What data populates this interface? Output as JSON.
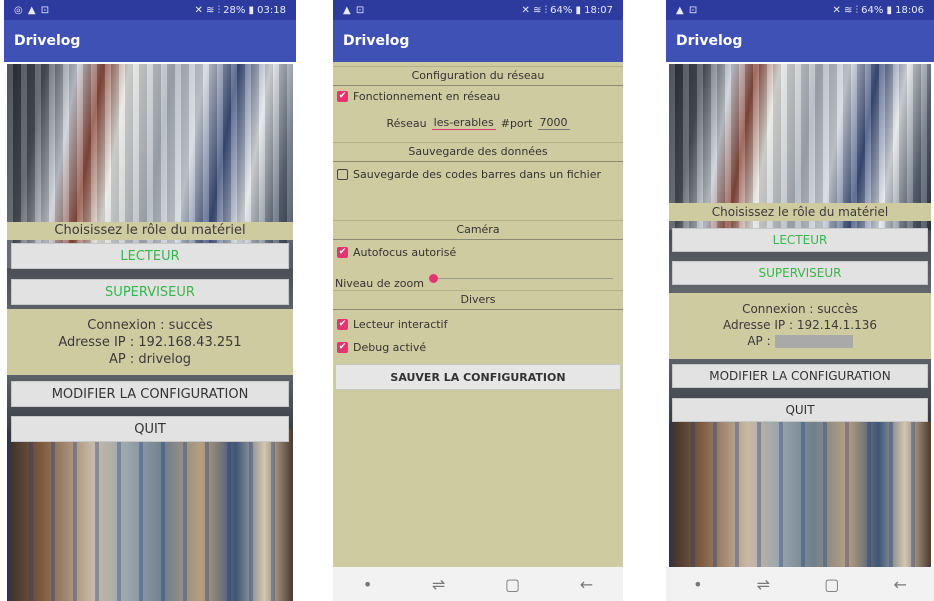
{
  "screens": [
    {
      "status": {
        "left": "◎ ▲ ⊡",
        "right": "28% ▮ 03:18"
      },
      "app_title": "Drivelog",
      "role_prompt": "Choisissez le rôle du matériel",
      "buttons": {
        "reader": "LECTEUR",
        "supervisor": "SUPERVISEUR",
        "modify": "MODIFIER LA CONFIGURATION",
        "quit": "QUIT"
      },
      "connection": {
        "status": "Connexion : succès",
        "ip": "Adresse IP : 192.168.43.251",
        "ap": "AP : drivelog"
      }
    },
    {
      "status": {
        "left": "▲ ⊡",
        "right": "64% ▮ 18:07"
      },
      "app_title": "Drivelog",
      "sections": {
        "network": "Configuration du réseau",
        "backup": "Sauvegarde des données",
        "camera": "Caméra",
        "misc": "Divers"
      },
      "options": {
        "network_mode": "Fonctionnement en réseau",
        "network_label": "Réseau",
        "network_value": "les-erables",
        "port_label": "#port",
        "port_value": "7000",
        "save_barcodes": "Sauvegarde des codes barres dans un fichier",
        "autofocus": "Autofocus autorisé",
        "zoom_label": "Niveau de zoom",
        "interactive_reader": "Lecteur interactif",
        "debug": "Debug activé"
      },
      "checks": {
        "network_mode": true,
        "save_barcodes": false,
        "autofocus": true,
        "interactive_reader": true,
        "debug": true
      },
      "zoom_level": 0,
      "save_button": "SAUVER LA CONFIGURATION"
    },
    {
      "status": {
        "left": "▲ ⊡",
        "right": "64% ▮ 18:06"
      },
      "app_title": "Drivelog",
      "role_prompt": "Choisissez le rôle du matériel",
      "buttons": {
        "reader": "LECTEUR",
        "supervisor": "SUPERVISEUR",
        "modify": "MODIFIER LA CONFIGURATION",
        "quit": "QUIT"
      },
      "connection": {
        "status": "Connexion : succès",
        "ip": "Adresse IP : 192.14.1.136",
        "ap": "AP :"
      }
    }
  ],
  "navbar_icons": [
    "dot-icon",
    "recent-apps-icon",
    "home-icon",
    "back-icon"
  ],
  "colors": {
    "app_bar": "#3f51b5",
    "status_bar": "#2d3a9e",
    "panel": "#cfcba0",
    "accent": "#e4356f",
    "green_text": "#39b54a"
  }
}
